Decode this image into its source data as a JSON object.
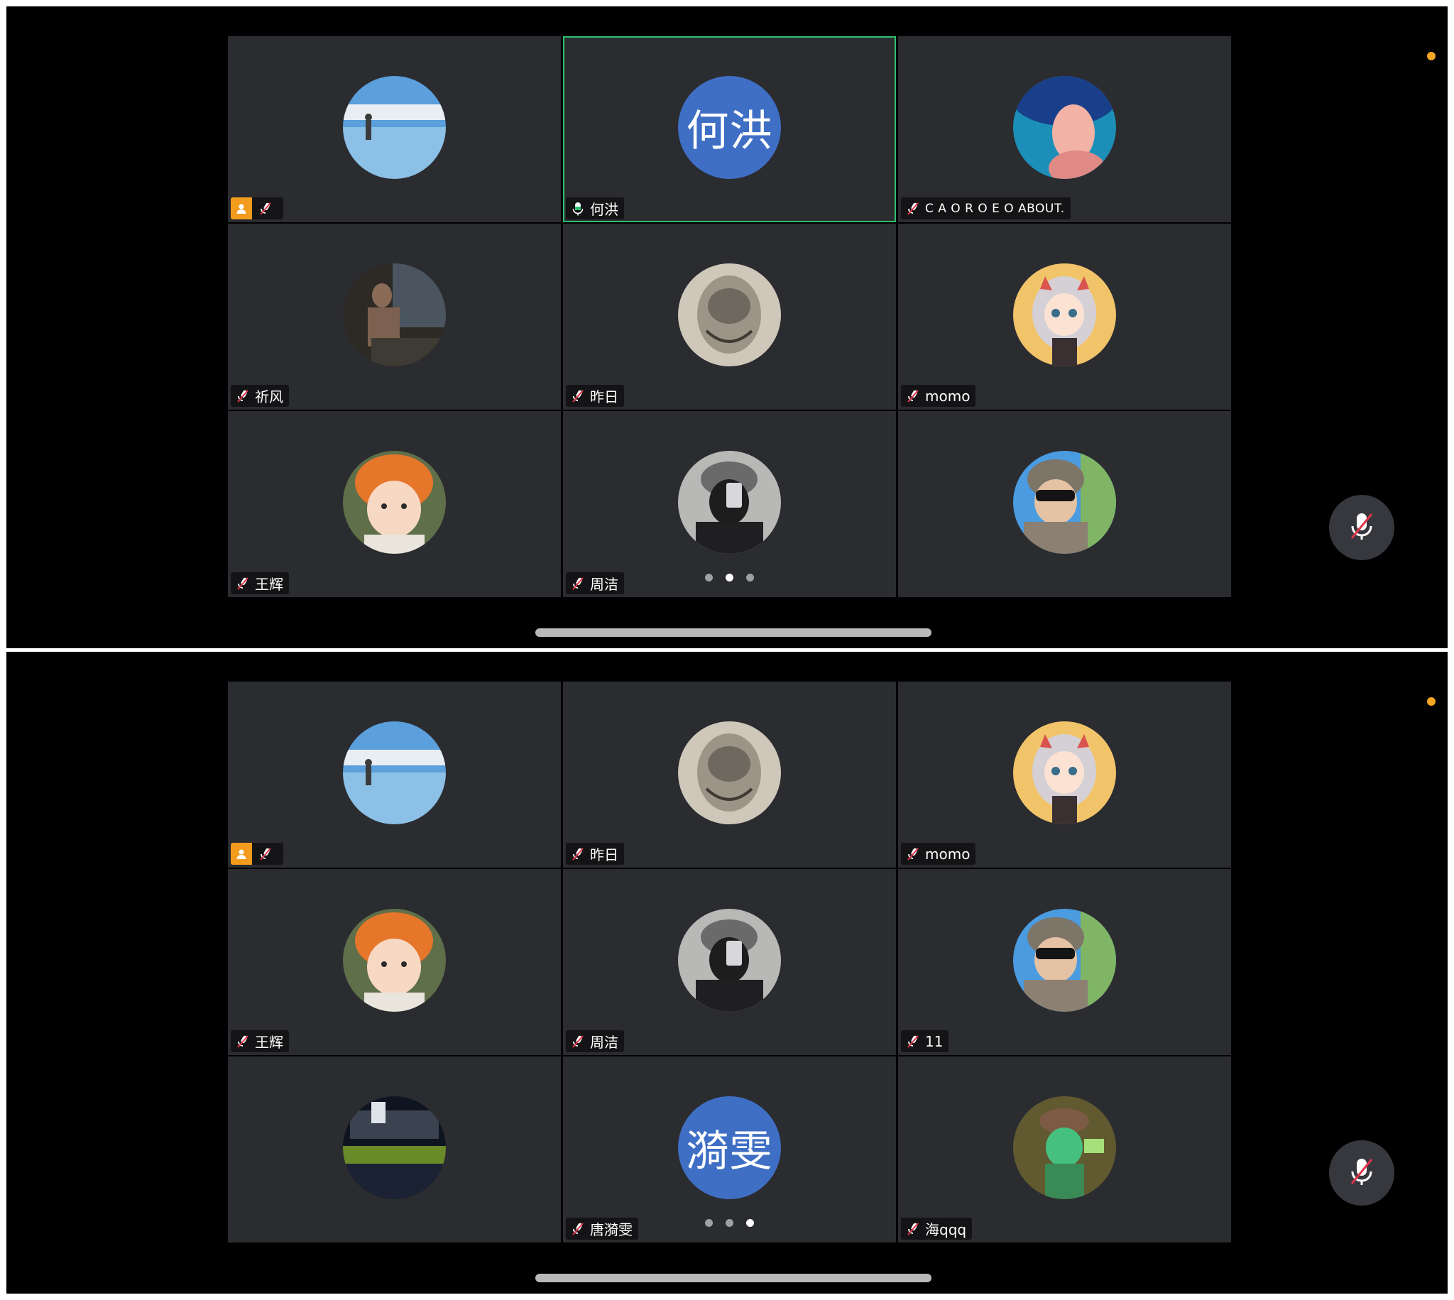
{
  "colors": {
    "speaker_border": "#2fbf71",
    "host_badge": "#f29b1d",
    "text_avatar": "#3e6fc4",
    "status_dot": "#f5a524"
  },
  "screens": [
    {
      "active_page": 1,
      "page_count": 3,
      "tiles": [
        {
          "name": "",
          "avatar": "landscape",
          "host": true,
          "mic": "muted",
          "speaking": false
        },
        {
          "name": "何洪",
          "avatar_text": "何洪",
          "mic": "active",
          "speaking": true
        },
        {
          "name": "C A O R O E O ABOUT.",
          "avatar": "blue-portrait",
          "mic": "muted",
          "spaced": true
        },
        {
          "name": "祈风",
          "avatar": "dark-room",
          "mic": "muted"
        },
        {
          "name": "昨日",
          "avatar": "sketch",
          "mic": "muted"
        },
        {
          "name": "momo",
          "avatar": "cartoon-girl",
          "mic": "muted"
        },
        {
          "name": "王辉",
          "avatar": "child-hat",
          "mic": "muted"
        },
        {
          "name": "周洁",
          "avatar": "selfie",
          "mic": "muted"
        },
        {
          "name": "",
          "avatar": "sunglasses",
          "mic": "none"
        }
      ]
    },
    {
      "active_page": 2,
      "page_count": 3,
      "tiles": [
        {
          "name": "",
          "avatar": "landscape",
          "host": true,
          "mic": "muted"
        },
        {
          "name": "昨日",
          "avatar": "sketch",
          "mic": "muted"
        },
        {
          "name": "momo",
          "avatar": "cartoon-girl",
          "mic": "muted"
        },
        {
          "name": "王辉",
          "avatar": "child-hat",
          "mic": "muted"
        },
        {
          "name": "周洁",
          "avatar": "selfie",
          "mic": "muted"
        },
        {
          "name": "11",
          "avatar": "sunglasses",
          "mic": "muted"
        },
        {
          "name": "",
          "avatar": "night-garden",
          "mic": "none"
        },
        {
          "name": "唐漪雯",
          "avatar_text": "漪雯",
          "mic": "muted"
        },
        {
          "name": "海qqq",
          "avatar": "green-cartoon",
          "mic": "muted"
        }
      ]
    }
  ],
  "icons": {
    "muted": "mic-muted-icon",
    "active": "mic-active-icon",
    "host": "host-person-icon",
    "toggle": "mic-toggle-icon"
  }
}
